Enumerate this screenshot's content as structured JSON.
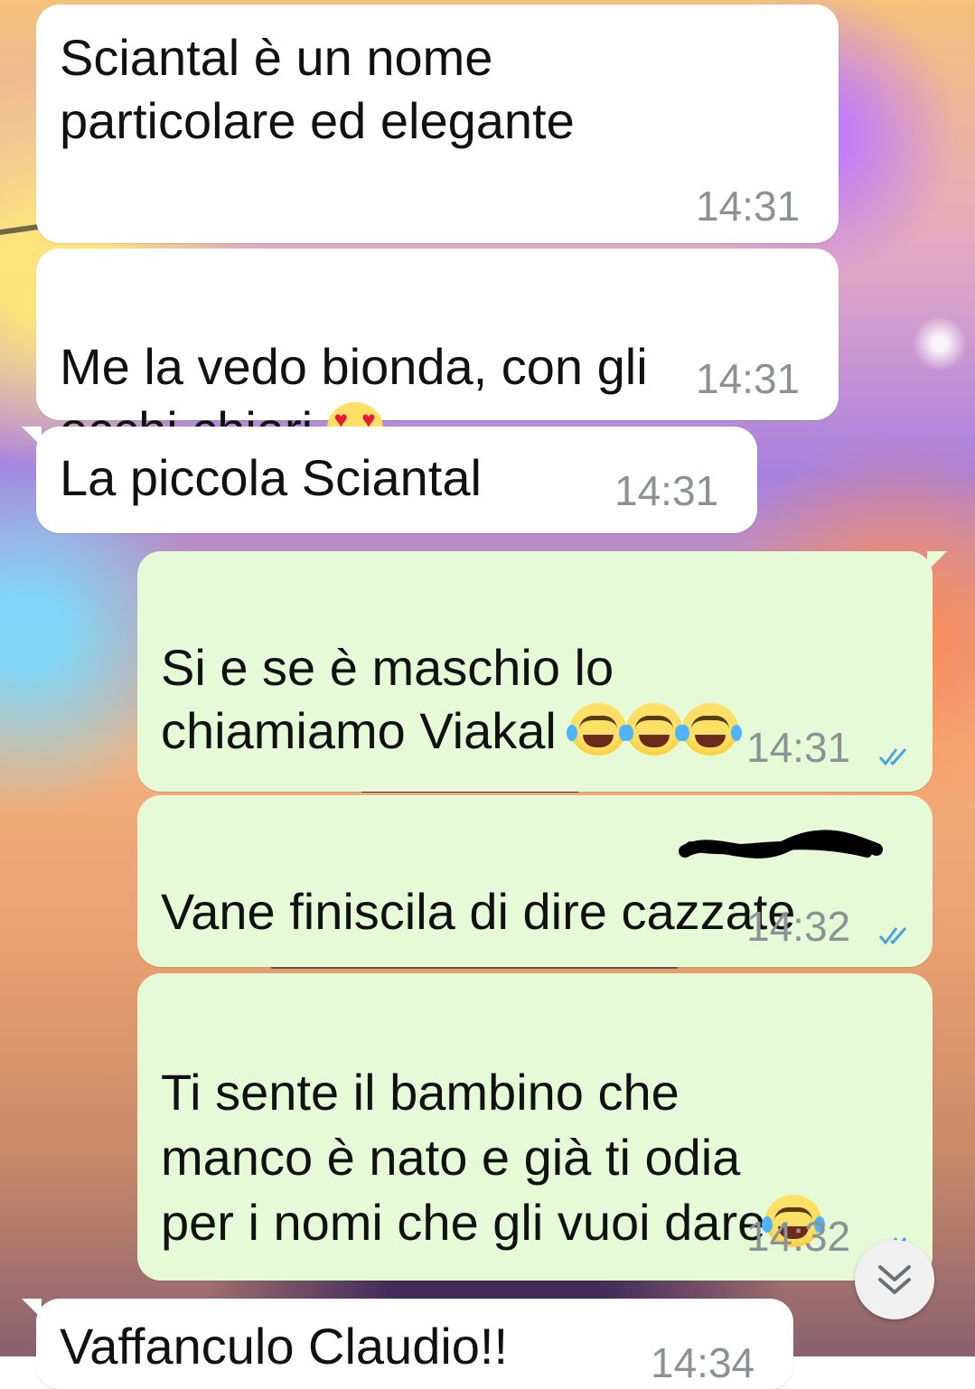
{
  "messages": [
    {
      "id": "m1",
      "direction": "incoming",
      "text": "Sciantal è un nome\nparticolare ed elegante",
      "time": "14:31"
    },
    {
      "id": "m2",
      "direction": "incoming",
      "text": "Me la vedo bionda, con gli\nocchi chiari",
      "emoji": "heart-eyes-emoji",
      "time": "14:31"
    },
    {
      "id": "m3",
      "direction": "incoming",
      "text": "La piccola Sciantal",
      "time": "14:31"
    },
    {
      "id": "m4",
      "direction": "outgoing",
      "text": "Si e se è maschio lo\nchiamiamo Viakal",
      "emoji": "tears-of-joy-emoji x3",
      "time": "14:31",
      "status": "read-ticks-icon"
    },
    {
      "id": "m5",
      "direction": "outgoing",
      "text": "Vane finiscila di dire cazzate",
      "time": "14:32",
      "status": "read-ticks-icon",
      "redacted_word_scribble": true
    },
    {
      "id": "m6",
      "direction": "outgoing",
      "text": "Ti sente il bambino che\nmanco è nato e già ti odia\nper i nomi che gli vuoi dare",
      "emoji": "tears-of-joy-emoji",
      "time": "14:32",
      "status": "read-ticks-icon"
    },
    {
      "id": "m7",
      "direction": "incoming",
      "text": "Vaffanculo Claudio!!",
      "time": "14:34"
    }
  ],
  "m5_visible_prefix": "Vane finiscila di dire ",
  "m5_scribbled_word": "cazzate",
  "scroll_button": {
    "icon": "double-chevron-down-icon"
  },
  "colors": {
    "incoming_bubble": "#ffffff",
    "outgoing_bubble": "#e7fad8",
    "read_tick": "#4aa3df",
    "time_text": "#8d9195"
  }
}
